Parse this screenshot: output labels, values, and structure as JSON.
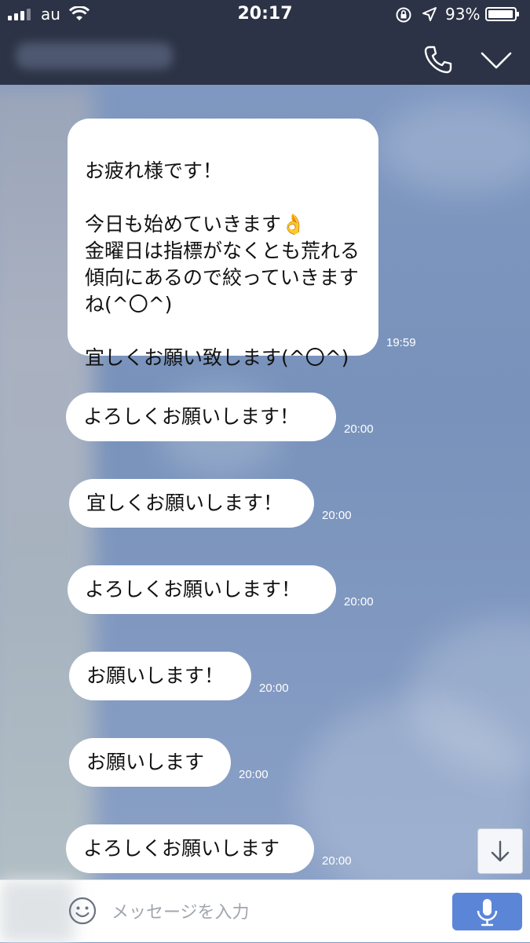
{
  "status_bar": {
    "carrier": "au",
    "time": "20:17",
    "battery": "93%",
    "battery_level": 0.93
  },
  "header": {
    "icons": [
      "phone-icon",
      "chevron-down-icon"
    ]
  },
  "messages": [
    {
      "text": "お疲れ様です！\n\n今日も始めていきます👌\n金曜日は指標がなくとも荒れる傾向にあるので絞っていきますね(^〇^)\n\n宜しくお願い致します(^〇^)",
      "time": "19:59"
    },
    {
      "text": "よろしくお願いします！",
      "time": "20:00"
    },
    {
      "text": "宜しくお願いします！",
      "time": "20:00"
    },
    {
      "text": "よろしくお願いします！",
      "time": "20:00"
    },
    {
      "text": "お願いします！",
      "time": "20:00"
    },
    {
      "text": "お願いします",
      "time": "20:00"
    },
    {
      "text": "よろしくお願いします",
      "time": "20:00"
    }
  ],
  "input": {
    "placeholder": "メッセージを入力"
  },
  "colors": {
    "header_bg": "#2c3346",
    "chat_bg": "#7f97bd",
    "mic_button": "#5b86d8"
  }
}
